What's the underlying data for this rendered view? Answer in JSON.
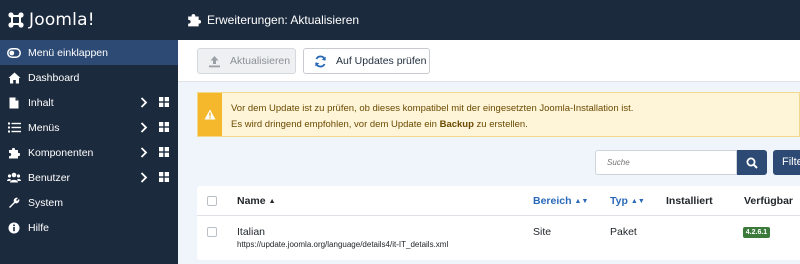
{
  "brand": {
    "name": "Joomla!"
  },
  "sidebar": {
    "items": [
      {
        "label": "Menü einklappen",
        "icon": "toggle-icon",
        "active": true
      },
      {
        "label": "Dashboard",
        "icon": "home-icon"
      },
      {
        "label": "Inhalt",
        "icon": "file-icon",
        "submenu": true
      },
      {
        "label": "Menüs",
        "icon": "list-icon",
        "submenu": true
      },
      {
        "label": "Komponenten",
        "icon": "puzzle-icon",
        "submenu": true
      },
      {
        "label": "Benutzer",
        "icon": "users-icon",
        "submenu": true
      },
      {
        "label": "System",
        "icon": "wrench-icon"
      },
      {
        "label": "Hilfe",
        "icon": "info-icon"
      }
    ]
  },
  "header": {
    "title": "Erweiterungen: Aktualisieren",
    "icon": "puzzle-icon"
  },
  "toolbar": {
    "update_label": "Aktualisieren",
    "check_label": "Auf Updates prüfen"
  },
  "alert": {
    "line1": "Vor dem Update ist zu prüfen, ob dieses kompatibel mit der eingesetzten Joomla-Installation ist.",
    "line2_prefix": "Es wird dringend empfohlen, vor dem Update ein ",
    "line2_bold": "Backup",
    "line2_suffix": " zu erstellen."
  },
  "search": {
    "placeholder": "Suche",
    "filter_label": "Filte"
  },
  "table": {
    "headers": {
      "name": "Name",
      "bereich": "Bereich",
      "typ": "Typ",
      "installiert": "Installiert",
      "verfuegbar": "Verfügbar"
    },
    "rows": [
      {
        "name": "Italian",
        "url": "https://update.joomla.org/language/details4/it-IT_details.xml",
        "bereich": "Site",
        "typ": "Paket",
        "installiert": "",
        "verfuegbar": "4.2.6.1"
      }
    ]
  },
  "colors": {
    "sidebar_bg": "#1c2a3e",
    "active_item": "#2d4a74",
    "alert_accent": "#f5b72c",
    "badge": "#3b7a3a",
    "link": "#2a69b8"
  }
}
